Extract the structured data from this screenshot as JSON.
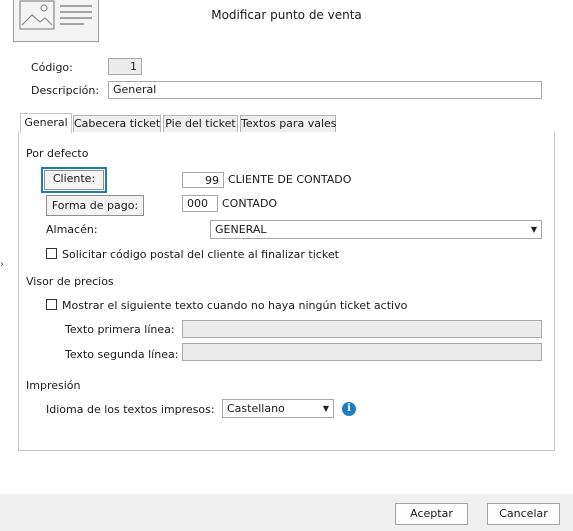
{
  "window": {
    "title": "Modificar punto de venta"
  },
  "form": {
    "codigo_label": "Código:",
    "codigo_value": "1",
    "descripcion_label": "Descripción:",
    "descripcion_value": "General"
  },
  "tabs": [
    {
      "label": "General",
      "active": true
    },
    {
      "label": "Cabecera ticket",
      "active": false
    },
    {
      "label": "Pie del ticket",
      "active": false
    },
    {
      "label": "Textos para vales",
      "active": false
    }
  ],
  "por_defecto": {
    "section_title": "Por defecto",
    "cliente_button": "Cliente:",
    "cliente_code": "99",
    "cliente_name": "CLIENTE DE CONTADO",
    "forma_pago_button": "Forma de pago:",
    "forma_pago_code": "000",
    "forma_pago_name": "CONTADO",
    "almacen_label": "Almacén:",
    "almacen_value": "GENERAL",
    "codigo_postal_checkbox": "Solicitar código postal del cliente al finalizar ticket"
  },
  "visor": {
    "section_title": "Visor de precios",
    "mostrar_checkbox": "Mostrar el siguiente texto cuando no haya ningún ticket activo",
    "linea1_label": "Texto primera línea:",
    "linea1_value": "",
    "linea2_label": "Texto segunda línea:",
    "linea2_value": ""
  },
  "impresion": {
    "section_title": "Impresión",
    "idioma_label": "Idioma de los textos impresos:",
    "idioma_value": "Castellano"
  },
  "buttons": {
    "aceptar": "Aceptar",
    "cancelar": "Cancelar"
  },
  "icons": {
    "logo": "image-placeholder-icon",
    "dropdown": "chevron-down-icon",
    "info": "info-icon",
    "side_arrow": "chevron-right-icon"
  },
  "colors": {
    "focus_border": "#1e7ea6",
    "info_icon": "#1f7ec2"
  }
}
